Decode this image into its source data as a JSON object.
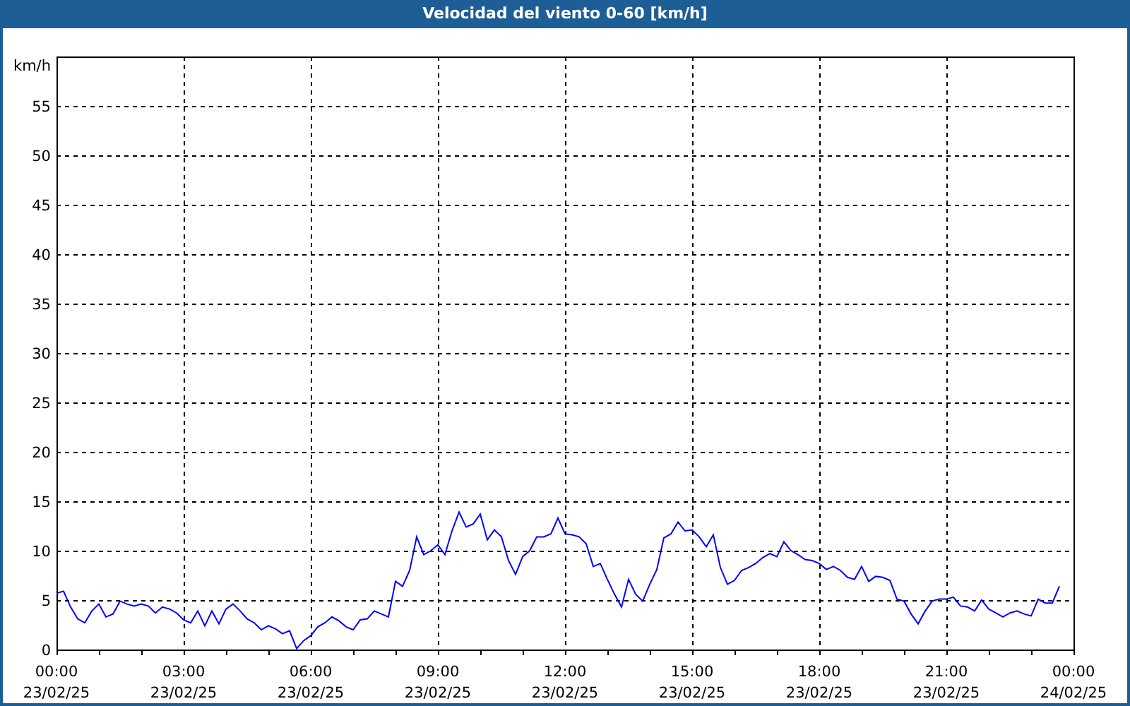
{
  "window": {
    "title": "Velocidad del viento 0-60 [km/h]"
  },
  "chart": {
    "chart_data": {
      "type": "line",
      "ylabel": "km/h",
      "ylim": [
        0,
        60
      ],
      "yticks": [
        0,
        5,
        10,
        15,
        20,
        25,
        30,
        35,
        40,
        45,
        50,
        55
      ],
      "grid": true,
      "categories": [
        "00:00\n23/02/25",
        null,
        null,
        null,
        null,
        null,
        null,
        null,
        null,
        null,
        null,
        null,
        null,
        null,
        null,
        null,
        null,
        null,
        "03:00\n23/02/25",
        null,
        null,
        null,
        null,
        null,
        null,
        null,
        null,
        null,
        null,
        null,
        null,
        null,
        null,
        null,
        null,
        null,
        "06:00\n23/02/25",
        null,
        null,
        null,
        null,
        null,
        null,
        null,
        null,
        null,
        null,
        null,
        null,
        null,
        null,
        null,
        null,
        null,
        "09:00\n23/02/25",
        null,
        null,
        null,
        null,
        null,
        null,
        null,
        null,
        null,
        null,
        null,
        null,
        null,
        null,
        null,
        null,
        null,
        "12:00\n23/02/25",
        null,
        null,
        null,
        null,
        null,
        null,
        null,
        null,
        null,
        null,
        null,
        null,
        null,
        null,
        null,
        null,
        null,
        "15:00\n23/02/25",
        null,
        null,
        null,
        null,
        null,
        null,
        null,
        null,
        null,
        null,
        null,
        null,
        null,
        null,
        null,
        null,
        null,
        "18:00\n23/02/25",
        null,
        null,
        null,
        null,
        null,
        null,
        null,
        null,
        null,
        null,
        null,
        null,
        null,
        null,
        null,
        null,
        null,
        "21:00\n23/02/25",
        null,
        null,
        null,
        null,
        null,
        null,
        null,
        null,
        null,
        null,
        null,
        null,
        null,
        null,
        null,
        null,
        null,
        "00:00\n24/02/25"
      ],
      "series": [
        {
          "color": "#0000ff",
          "values": [
            5.7,
            5.9,
            4.3,
            3.1,
            2.7,
            3.9,
            4.6,
            3.3,
            3.6,
            4.9,
            4.6,
            4.4,
            4.6,
            4.4,
            3.7,
            4.3,
            4.1,
            3.7,
            3.0,
            2.7,
            3.9,
            2.4,
            3.9,
            2.6,
            4.1,
            4.6,
            3.9,
            3.1,
            2.7,
            2.0,
            2.4,
            2.1,
            1.6,
            1.9,
            0.1,
            0.9,
            1.4,
            2.3,
            2.7,
            3.3,
            2.9,
            2.3,
            2.0,
            3.0,
            3.1,
            3.9,
            3.6,
            3.3,
            6.9,
            6.4,
            8.0,
            11.4,
            9.6,
            10.0,
            10.6,
            9.6,
            12.0,
            13.9,
            12.4,
            12.7,
            13.7,
            11.1,
            12.1,
            11.4,
            9.0,
            7.6,
            9.4,
            10.0,
            11.4,
            11.4,
            11.7,
            13.3,
            11.7,
            11.6,
            11.4,
            10.7,
            8.4,
            8.7,
            7.1,
            5.6,
            4.3,
            7.1,
            5.6,
            4.9,
            6.6,
            8.1,
            11.3,
            11.7,
            12.9,
            12.0,
            12.1,
            11.4,
            10.4,
            11.6,
            8.3,
            6.6,
            7.0,
            8.0,
            8.3,
            8.7,
            9.3,
            9.7,
            9.4,
            10.9,
            10.0,
            9.6,
            9.1,
            9.0,
            8.7,
            8.1,
            8.4,
            8.0,
            7.3,
            7.1,
            8.4,
            6.9,
            7.4,
            7.3,
            7.0,
            5.1,
            4.9,
            3.6,
            2.6,
            3.9,
            4.9,
            5.1,
            5.1,
            5.3,
            4.4,
            4.3,
            3.9,
            5.0,
            4.1,
            3.7,
            3.3,
            3.7,
            3.9,
            3.6,
            3.4,
            5.1,
            4.7,
            4.7,
            6.4,
            null,
            null
          ]
        }
      ]
    }
  }
}
